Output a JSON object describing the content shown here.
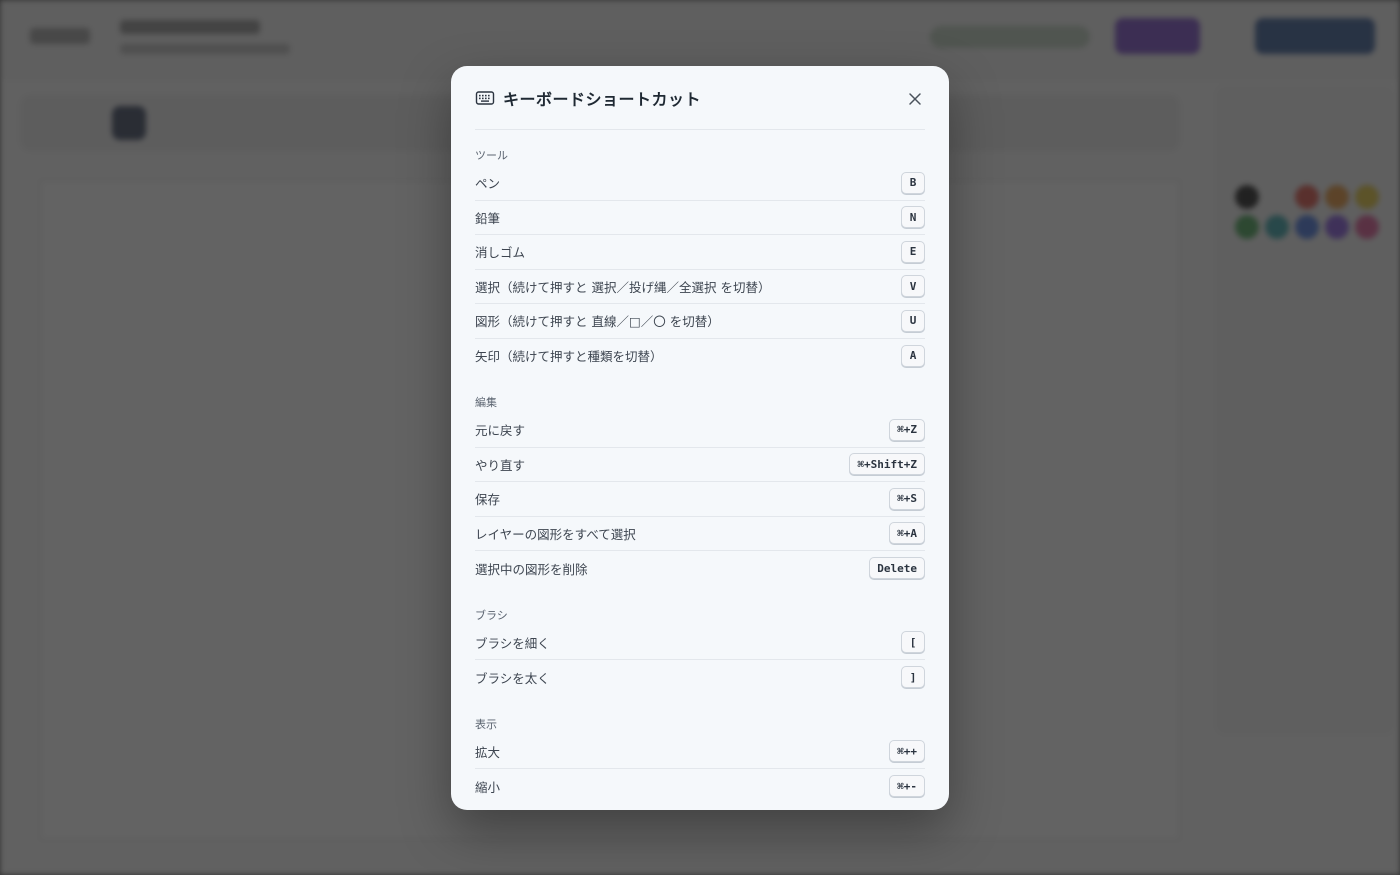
{
  "dialog": {
    "title": "キーボードショートカット",
    "icon": "keyboard-icon",
    "close_icon": "close-icon"
  },
  "sections": [
    {
      "title": "ツール",
      "items": [
        {
          "label": "ペン",
          "key": "B"
        },
        {
          "label": "鉛筆",
          "key": "N"
        },
        {
          "label": "消しゴム",
          "key": "E"
        },
        {
          "label": "選択（続けて押すと 選択／投げ縄／全選択 を切替）",
          "key": "V"
        },
        {
          "label": "図形（続けて押すと 直線／□／〇 を切替）",
          "key": "U"
        },
        {
          "label": "矢印（続けて押すと種類を切替）",
          "key": "A"
        }
      ]
    },
    {
      "title": "編集",
      "items": [
        {
          "label": "元に戻す",
          "key": "⌘+Z"
        },
        {
          "label": "やり直す",
          "key": "⌘+Shift+Z"
        },
        {
          "label": "保存",
          "key": "⌘+S"
        },
        {
          "label": "レイヤーの図形をすべて選択",
          "key": "⌘+A"
        },
        {
          "label": "選択中の図形を削除",
          "key": "Delete"
        }
      ]
    },
    {
      "title": "ブラシ",
      "items": [
        {
          "label": "ブラシを細く",
          "key": "["
        },
        {
          "label": "ブラシを太く",
          "key": "]"
        }
      ]
    },
    {
      "title": "表示",
      "items": [
        {
          "label": "拡大",
          "key": "⌘++"
        },
        {
          "label": "縮小",
          "key": "⌘+-"
        }
      ]
    }
  ],
  "colors": {
    "overlay": "#282828",
    "modal_bg": "#f5f8fb",
    "accent_purple": "#6f3fc0",
    "accent_blue": "#2a4f8c"
  }
}
